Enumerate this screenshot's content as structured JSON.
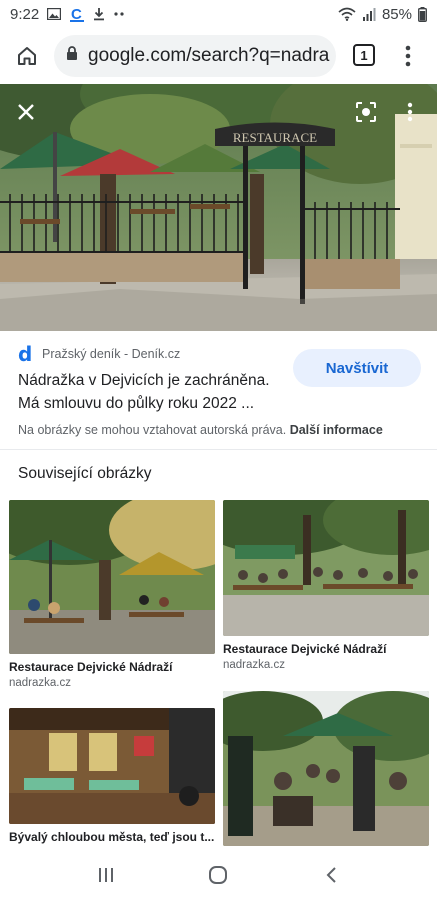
{
  "status_bar": {
    "time": "9:22",
    "battery": "85%",
    "icons": [
      "gallery-icon",
      "c-app-icon",
      "download-icon",
      "more-notifications-icon",
      "wifi-icon",
      "signal-icon",
      "battery-icon"
    ]
  },
  "browser": {
    "url": "google.com/search?q=nadra",
    "tab_count": "1",
    "icons": [
      "home-icon",
      "lock-icon",
      "tab-switcher-icon",
      "overflow-menu-icon"
    ]
  },
  "hero": {
    "sign_text": "RESTAURACE",
    "icons": [
      "close-icon",
      "lens-icon",
      "more-vertical-icon"
    ]
  },
  "result": {
    "source": "Pražský deník - Deník.cz",
    "source_logo_letter": "d",
    "title": "Nádražka v Dejvicích je zachráněna. Má smlouvu do půlky roku 2022 ...",
    "visit_label": "Navštívit",
    "copyright_text": "Na obrázky se mohou vztahovat autorská práva.",
    "copyright_more": "Další informace"
  },
  "related": {
    "heading": "Související obrázky",
    "cards": [
      {
        "title": "Restaurace Dejvické Nádraží",
        "source": "nadrazka.cz"
      },
      {
        "title": "Restaurace Dejvické Nádraží",
        "source": "nadrazka.cz"
      },
      {
        "title": "Bývalý chloubou města, teď jsou t...",
        "source": ""
      },
      {
        "title": "",
        "source": ""
      }
    ]
  },
  "colors": {
    "accent": "#1a73e8",
    "visit_bg": "#e8f0fe",
    "visit_text": "#1967d2",
    "muted_text": "#5f6368"
  },
  "nav": {
    "icons": [
      "recent-apps-icon",
      "home-circle-icon",
      "back-icon"
    ]
  }
}
